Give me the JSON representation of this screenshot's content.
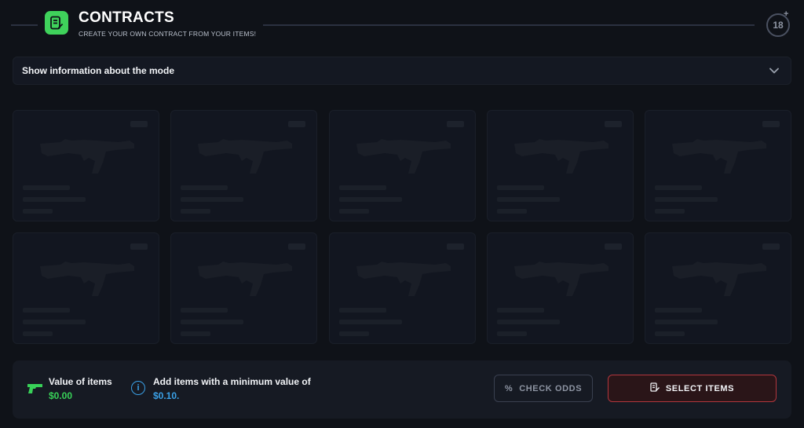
{
  "header": {
    "title": "CONTRACTS",
    "subtitle": "CREATE YOUR OWN CONTRACT FROM YOUR ITEMS!",
    "age_badge": "18",
    "age_plus": "+",
    "accent_color": "#3fd25b"
  },
  "info_bar": {
    "label": "Show information about the mode",
    "icon": "chevron-down-icon"
  },
  "slots": {
    "count": 10,
    "state": "empty-placeholder",
    "icon": "rifle-icon"
  },
  "bottom": {
    "value_label": "Value of items",
    "value_amount": "$0.00",
    "min_label": "Add items with a minimum value of",
    "min_amount": "$0.10.",
    "info_icon_glyph": "i",
    "check_odds_symbol": "%",
    "check_odds_label": "CHECK ODDS",
    "select_items_label": "SELECT ITEMS",
    "colors": {
      "value_green": "#38d158",
      "info_blue": "#3aa0e6",
      "select_border_red": "#b2363d"
    }
  }
}
